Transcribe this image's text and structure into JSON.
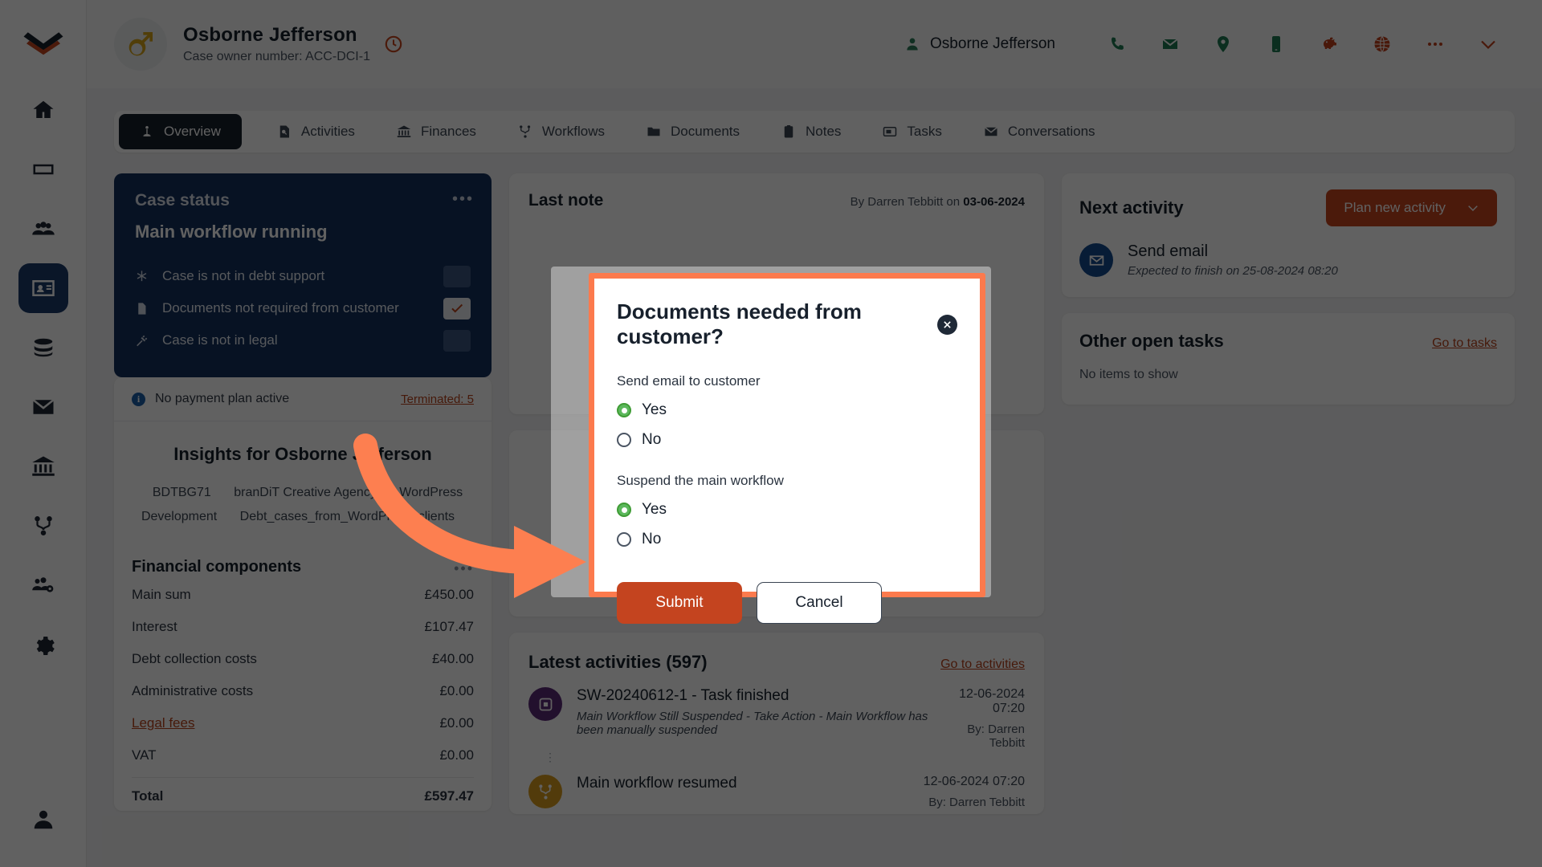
{
  "sidebar": {
    "logo": "logo-icon",
    "items": [
      {
        "name": "home",
        "icon": "home-icon",
        "active": false
      },
      {
        "name": "cases",
        "icon": "card-icon",
        "active": false
      },
      {
        "name": "customers",
        "icon": "people-icon",
        "active": false
      },
      {
        "name": "contacts",
        "icon": "id-card-icon",
        "active": true
      },
      {
        "name": "data",
        "icon": "database-icon",
        "active": false
      },
      {
        "name": "mail",
        "icon": "envelope-icon",
        "active": false
      },
      {
        "name": "finances",
        "icon": "bank-icon",
        "active": false
      },
      {
        "name": "workflows",
        "icon": "workflow-icon",
        "active": false
      },
      {
        "name": "teams",
        "icon": "team-settings-icon",
        "active": false
      },
      {
        "name": "settings",
        "icon": "gear-icon",
        "active": false
      }
    ],
    "bottom": {
      "name": "user-account",
      "icon": "user-avatar-icon"
    }
  },
  "header": {
    "avatar_icon": "male-gender-icon",
    "name": "Osborne Jefferson",
    "case_owner_number": "Case owner number: ACC-DCI-1",
    "eye_icon": "eye-icon",
    "contact_name": "Osborne Jefferson",
    "contact_person_icon": "person-icon",
    "icons": [
      {
        "name": "phone-icon",
        "color": "#1f7a52"
      },
      {
        "name": "email-icon",
        "color": "#1f7a52"
      },
      {
        "name": "location-pin-icon",
        "color": "#1f7a52"
      },
      {
        "name": "mobile-phone-icon",
        "color": "#1f7a52"
      },
      {
        "name": "piggy-bank-icon",
        "color": "#c0401c"
      },
      {
        "name": "globe-icon",
        "color": "#c0401c"
      },
      {
        "name": "more-options-icon",
        "color": "#c0401c"
      },
      {
        "name": "chevron-down-icon",
        "color": "#c0401c"
      }
    ]
  },
  "tabs": [
    {
      "label": "Overview",
      "icon": "overview-icon",
      "active": true
    },
    {
      "label": "Activities",
      "icon": "activities-icon",
      "active": false
    },
    {
      "label": "Finances",
      "icon": "bank-icon",
      "active": false
    },
    {
      "label": "Workflows",
      "icon": "workflow-icon",
      "active": false
    },
    {
      "label": "Documents",
      "icon": "folder-icon",
      "active": false
    },
    {
      "label": "Notes",
      "icon": "note-icon",
      "active": false
    },
    {
      "label": "Tasks",
      "icon": "tasks-icon",
      "active": false
    },
    {
      "label": "Conversations",
      "icon": "conversations-icon",
      "active": false
    }
  ],
  "case_status": {
    "title": "Case status",
    "subtitle": "Main workflow running",
    "menu_icon": "more-options-icon",
    "rows": [
      {
        "icon": "asterisk-icon",
        "label": "Case is not in debt support",
        "checked": false
      },
      {
        "icon": "document-icon",
        "label": "Documents not required from customer",
        "checked": true
      },
      {
        "icon": "gavel-icon",
        "label": "Case is not in legal",
        "checked": false
      }
    ]
  },
  "payment_plan": {
    "info_char": "i",
    "text": "No payment plan active",
    "link": "Terminated: 5"
  },
  "insights": {
    "title": "Insights for Osborne Jefferson",
    "tags": [
      "BDTBG71",
      "branDiT Creative Agency",
      "WordPress Development",
      "Debt_cases_from_WordPress_clients"
    ]
  },
  "financial": {
    "title": "Financial components",
    "menu_icon": "more-options-icon",
    "rows": [
      {
        "label": "Main sum",
        "value": "£450.00",
        "link": false
      },
      {
        "label": "Interest",
        "value": "£107.47",
        "link": false
      },
      {
        "label": "Debt collection costs",
        "value": "£40.00",
        "link": false
      },
      {
        "label": "Administrative costs",
        "value": "£0.00",
        "link": false
      },
      {
        "label": "Legal fees",
        "value": "£0.00",
        "link": true
      },
      {
        "label": "VAT",
        "value": "£0.00",
        "link": false
      }
    ],
    "total": {
      "label": "Total",
      "value": "£597.47"
    }
  },
  "last_note": {
    "title": "Last note",
    "meta_prefix": "By Darren Tebbitt on",
    "meta_date": "03-06-2024"
  },
  "next_activity": {
    "title": "Next activity",
    "button_label": "Plan new activity",
    "button_icon": "chevron-down-icon",
    "item_icon": "envelope-icon",
    "item_title": "Send email",
    "item_sub": "Expected to finish on 25-08-2024 08:20"
  },
  "open_tasks": {
    "title": "Other open tasks",
    "link": "Go to tasks",
    "empty": "No items to show"
  },
  "tasks_link_partial": "tasks",
  "latest_activities": {
    "title": "Latest activities (597)",
    "link": "Go to activities",
    "items": [
      {
        "icon": "task-square-icon",
        "icon_color": "#5b2a78",
        "title": "SW-20240612-1 - Task finished",
        "subtitle": "Main Workflow Still Suspended - Take Action - Main Workflow has been manually suspended",
        "date": "12-06-2024 07:20",
        "by": "By: Darren Tebbitt"
      },
      {
        "icon": "workflow-icon",
        "icon_color": "#d89c1e",
        "title": "Main workflow resumed",
        "subtitle": "",
        "date": "12-06-2024 07:20",
        "by": "By: Darren Tebbitt"
      }
    ]
  },
  "modal": {
    "title": "Documents needed from customer?",
    "close_icon": "close-icon",
    "fields": [
      {
        "label": "Send email to customer",
        "options": [
          {
            "label": "Yes",
            "selected": true
          },
          {
            "label": "No",
            "selected": false
          }
        ]
      },
      {
        "label": "Suspend the main workflow",
        "options": [
          {
            "label": "Yes",
            "selected": true
          },
          {
            "label": "No",
            "selected": false
          }
        ]
      }
    ],
    "submit_label": "Submit",
    "cancel_label": "Cancel",
    "highlight_color": "#fc7a4d"
  },
  "annotation": {
    "arrow_color": "#fd7f50"
  }
}
